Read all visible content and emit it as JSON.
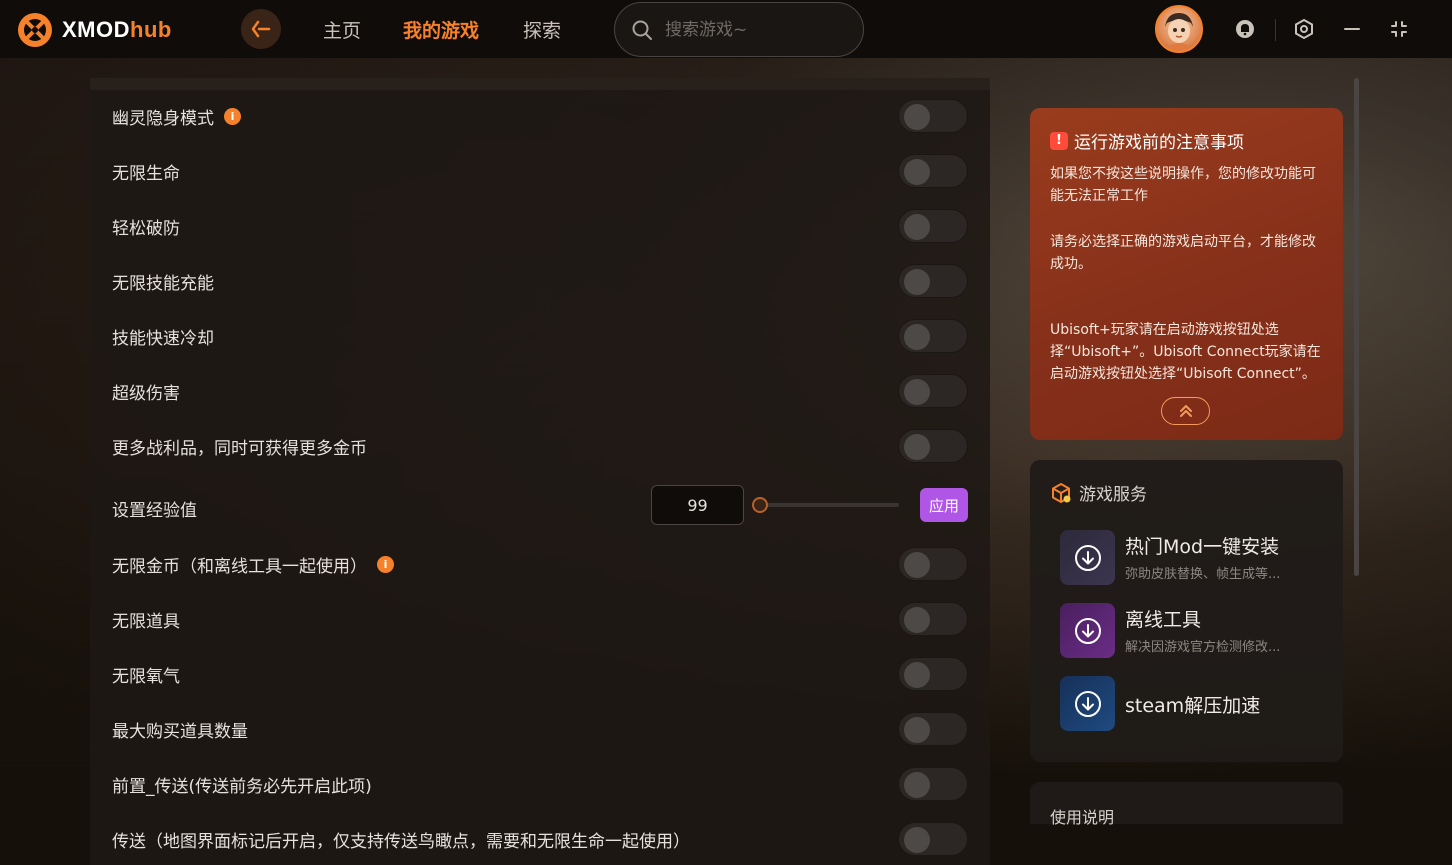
{
  "app": {
    "logo_brand": "XMOD",
    "logo_suffix": "hub"
  },
  "nav": {
    "home": "主页",
    "my_games": "我的游戏",
    "explore": "探索",
    "active": "我的游戏"
  },
  "search": {
    "placeholder": "搜索游戏~"
  },
  "colors": {
    "accent": "#f5822a",
    "apply_button": "#b056e6",
    "notice_card": "#8a321a"
  },
  "cheats": [
    {
      "label": "幽灵隐身模式",
      "info": true,
      "control": "toggle",
      "enabled": false
    },
    {
      "label": "无限生命",
      "control": "toggle",
      "enabled": false
    },
    {
      "label": "轻松破防",
      "control": "toggle",
      "enabled": false
    },
    {
      "label": "无限技能充能",
      "control": "toggle",
      "enabled": false
    },
    {
      "label": "技能快速冷却",
      "control": "toggle",
      "enabled": false
    },
    {
      "label": "超级伤害",
      "control": "toggle",
      "enabled": false
    },
    {
      "label": "更多战利品，同时可获得更多金币",
      "control": "toggle",
      "enabled": false
    },
    {
      "label": "设置经验值",
      "control": "slider",
      "value": "99",
      "slider_level": 0,
      "apply_label": "应用"
    },
    {
      "label": "无限金币（和离线工具一起使用）",
      "info": true,
      "control": "toggle",
      "enabled": false
    },
    {
      "label": "无限道具",
      "control": "toggle",
      "enabled": false
    },
    {
      "label": "无限氧气",
      "control": "toggle",
      "enabled": false
    },
    {
      "label": "最大购买道具数量",
      "control": "toggle",
      "enabled": false
    },
    {
      "label": "前置_传送(传送前务必先开启此项)",
      "control": "toggle",
      "enabled": false
    },
    {
      "label": "传送（地图界面标记后开启，仅支持传送鸟瞰点，需要和无限生命一起使用）",
      "control": "toggle",
      "enabled": false
    }
  ],
  "info_icon_glyph": "i",
  "notice": {
    "icon_glyph": "!",
    "title": "运行游戏前的注意事项",
    "p1": "如果您不按这些说明操作，您的修改功能可能无法正常工作",
    "p2": "请务必选择正确的游戏启动平台，才能修改成功。",
    "p3": "Ubisoft+玩家请在启动游戏按钮处选择“Ubisoft+”。Ubisoft Connect玩家请在启动游戏按钮处选择“Ubisoft Connect”。"
  },
  "services": {
    "title": "游戏服务",
    "items": [
      {
        "name": "热门Mod一键安装",
        "desc": "弥助皮肤替换、帧生成等...",
        "icon": "download-icon"
      },
      {
        "name": "离线工具",
        "desc": "解决因游戏官方检测修改...",
        "icon": "download-icon"
      },
      {
        "name": "steam解压加速",
        "desc": "",
        "icon": "download-icon"
      }
    ]
  },
  "usage": {
    "title": "使用说明"
  }
}
